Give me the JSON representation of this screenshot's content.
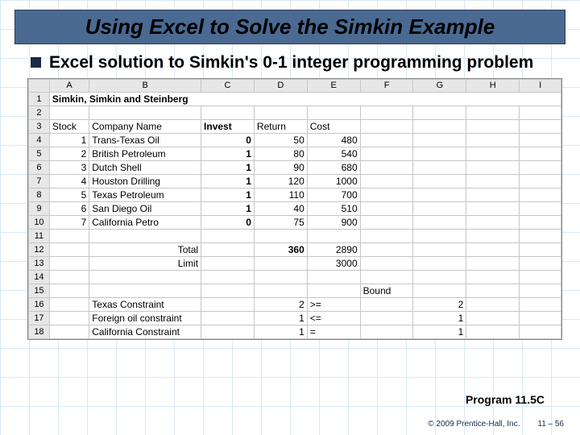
{
  "title": "Using Excel to Solve the Simkin Example",
  "bullet": "Excel solution to Simkin's 0-1 integer programming problem",
  "caption": "Program 11.5C",
  "footer": {
    "copyright": "© 2009 Prentice-Hall, Inc.",
    "pagenum": "11 – 56"
  },
  "excel": {
    "columns": [
      "",
      "A",
      "B",
      "C",
      "D",
      "E",
      "F",
      "G",
      "H",
      "I"
    ],
    "rows": [
      {
        "n": "1",
        "cells": {
          "A": "Simkin, Simkin and Steinberg"
        },
        "boldA": true,
        "spanA": true
      },
      {
        "n": "2",
        "cells": {}
      },
      {
        "n": "3",
        "cells": {
          "A": "Stock",
          "B": "Company Name",
          "C": "Invest",
          "D": "Return",
          "E": "Cost"
        },
        "boldC": true,
        "alA": "left",
        "alC": "left",
        "alD": "left",
        "alE": "left"
      },
      {
        "n": "4",
        "cells": {
          "A": "1",
          "B": "Trans-Texas Oil",
          "C": "0",
          "D": "50",
          "E": "480"
        },
        "boldC": true
      },
      {
        "n": "5",
        "cells": {
          "A": "2",
          "B": "British Petroleum",
          "C": "1",
          "D": "80",
          "E": "540"
        },
        "boldC": true
      },
      {
        "n": "6",
        "cells": {
          "A": "3",
          "B": "Dutch Shell",
          "C": "1",
          "D": "90",
          "E": "680"
        },
        "boldC": true
      },
      {
        "n": "7",
        "cells": {
          "A": "4",
          "B": "Houston Drilling",
          "C": "1",
          "D": "120",
          "E": "1000"
        },
        "boldC": true
      },
      {
        "n": "8",
        "cells": {
          "A": "5",
          "B": "Texas Petroleum",
          "C": "1",
          "D": "110",
          "E": "700"
        },
        "boldC": true
      },
      {
        "n": "9",
        "cells": {
          "A": "6",
          "B": "San Diego Oil",
          "C": "1",
          "D": "40",
          "E": "510"
        },
        "boldC": true
      },
      {
        "n": "10",
        "cells": {
          "A": "7",
          "B": "California Petro",
          "C": "0",
          "D": "75",
          "E": "900"
        },
        "boldC": true
      },
      {
        "n": "11",
        "cells": {}
      },
      {
        "n": "12",
        "cells": {
          "B": "Total",
          "D": "360",
          "E": "2890"
        },
        "alB": "right",
        "boldD": true
      },
      {
        "n": "13",
        "cells": {
          "B": "Limit",
          "E": "3000"
        },
        "alB": "right"
      },
      {
        "n": "14",
        "cells": {}
      },
      {
        "n": "15",
        "cells": {
          "F": "Bound"
        }
      },
      {
        "n": "16",
        "cells": {
          "B": "Texas Constraint",
          "D": "2",
          "E": ">=",
          "G": "2"
        },
        "alE": "left"
      },
      {
        "n": "17",
        "cells": {
          "B": "Foreign oil constraint",
          "D": "1",
          "E": "<=",
          "G": "1"
        },
        "alE": "left"
      },
      {
        "n": "18",
        "cells": {
          "B": "California Constraint",
          "D": "1",
          "E": "=",
          "G": "1"
        },
        "alE": "left"
      }
    ]
  },
  "chart_data": {
    "type": "table",
    "title": "Simkin, Simkin and Steinberg",
    "columns": [
      "Stock",
      "Company Name",
      "Invest",
      "Return",
      "Cost"
    ],
    "data": [
      [
        1,
        "Trans-Texas Oil",
        0,
        50,
        480
      ],
      [
        2,
        "British Petroleum",
        1,
        80,
        540
      ],
      [
        3,
        "Dutch Shell",
        1,
        90,
        680
      ],
      [
        4,
        "Houston Drilling",
        1,
        120,
        1000
      ],
      [
        5,
        "Texas Petroleum",
        1,
        110,
        700
      ],
      [
        6,
        "San Diego Oil",
        1,
        40,
        510
      ],
      [
        7,
        "California Petro",
        0,
        75,
        900
      ]
    ],
    "totals": {
      "Return": 360,
      "Cost": 2890
    },
    "limit": {
      "Cost": 3000
    },
    "constraints": [
      {
        "name": "Texas Constraint",
        "value": 2,
        "op": ">=",
        "bound": 2
      },
      {
        "name": "Foreign oil constraint",
        "value": 1,
        "op": "<=",
        "bound": 1
      },
      {
        "name": "California Constraint",
        "value": 1,
        "op": "=",
        "bound": 1
      }
    ]
  }
}
